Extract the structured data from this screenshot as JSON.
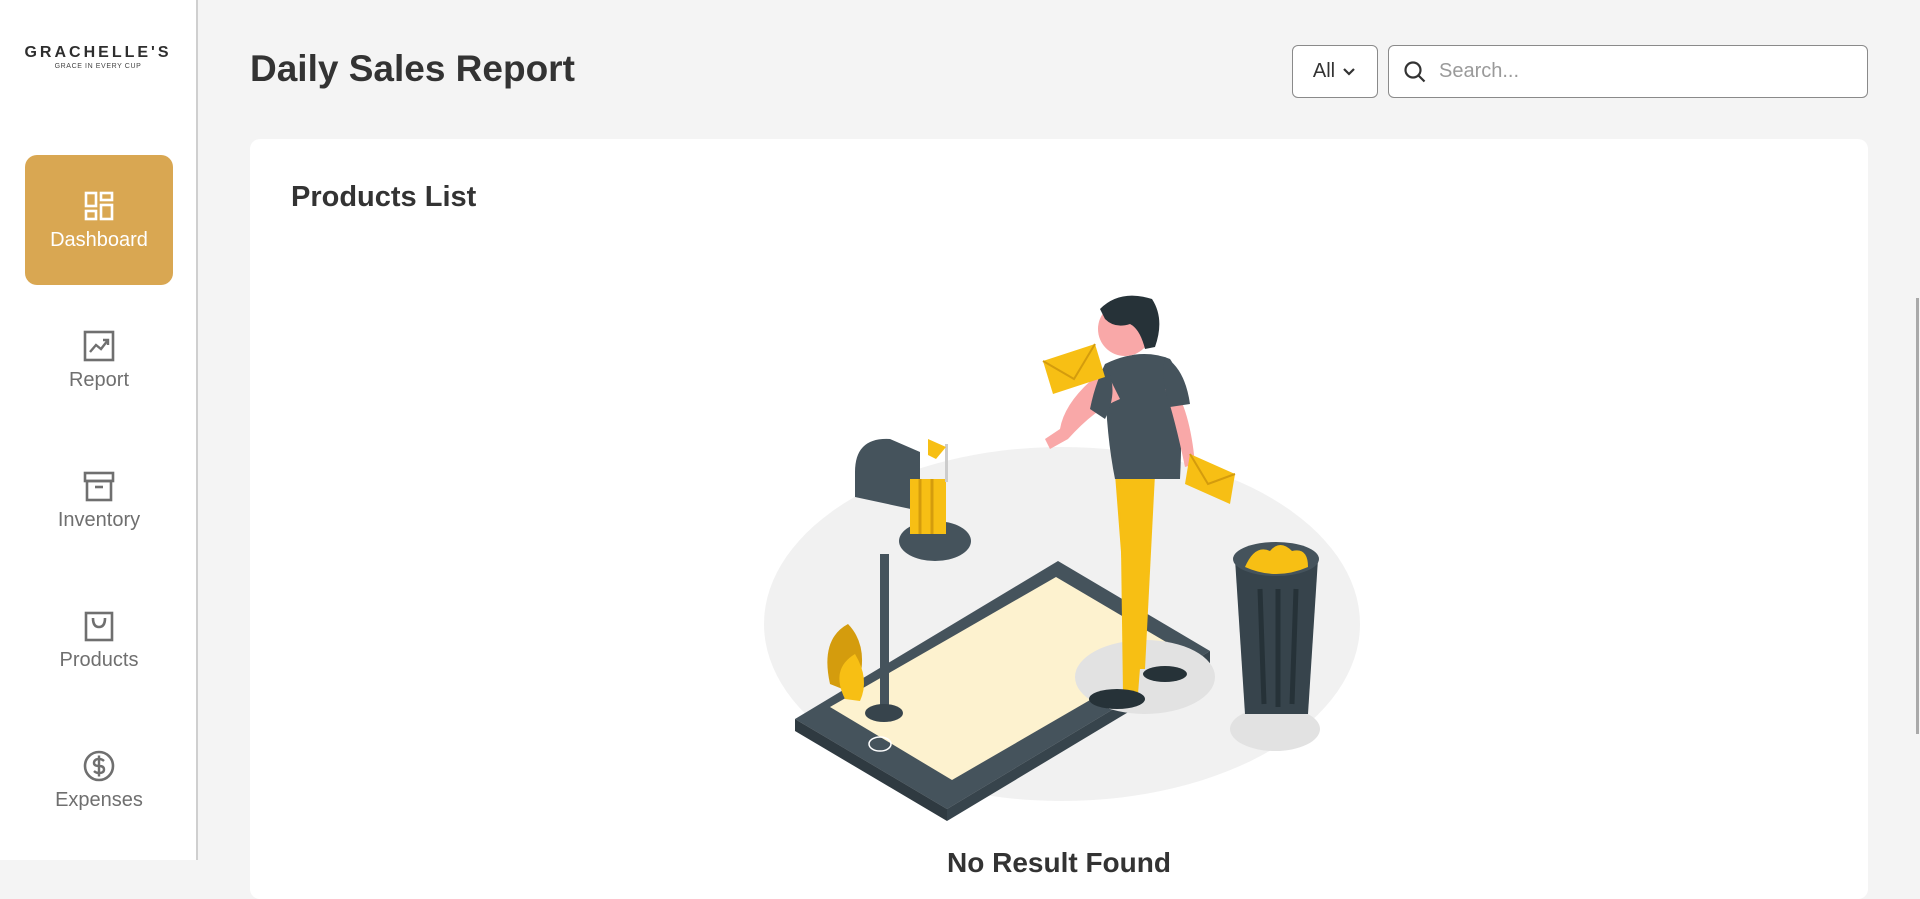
{
  "sidebar": {
    "brand_name": "GRACHELLE'S",
    "brand_tagline": "GRACE IN EVERY CUP",
    "items": [
      {
        "label": "Dashboard",
        "icon": "dashboard-icon",
        "active": true
      },
      {
        "label": "Report",
        "icon": "report-icon",
        "active": false
      },
      {
        "label": "Inventory",
        "icon": "inventory-icon",
        "active": false
      },
      {
        "label": "Products",
        "icon": "products-icon",
        "active": false
      },
      {
        "label": "Expenses",
        "icon": "expenses-icon",
        "active": false
      }
    ]
  },
  "header": {
    "title": "Daily Sales Report",
    "filter_value": "All",
    "search_placeholder": "Search..."
  },
  "card": {
    "title": "Products List",
    "empty_message": "No Result Found"
  },
  "colors": {
    "accent": "#d9a752",
    "illustration_yellow": "#f7bf14",
    "illustration_dark": "#45535c",
    "background": "#f4f4f4"
  }
}
